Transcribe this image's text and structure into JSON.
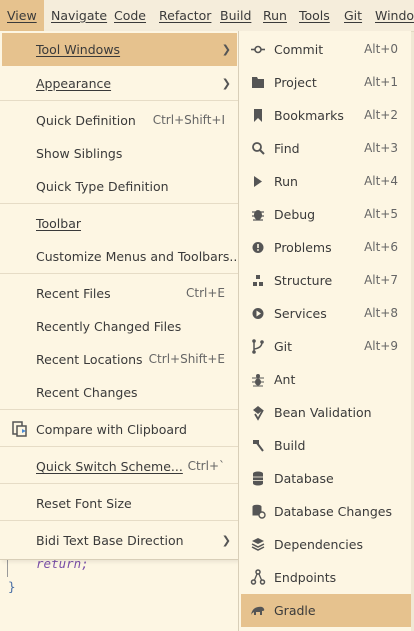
{
  "menubar": {
    "items": [
      "View",
      "Navigate",
      "Code",
      "Refactor",
      "Build",
      "Run",
      "Tools",
      "Git",
      "Window"
    ]
  },
  "view_menu": {
    "items": [
      {
        "label": "Tool Windows",
        "shortcut": "",
        "submenu": true,
        "selected": true
      },
      {
        "label": "Appearance",
        "shortcut": "",
        "submenu": true
      },
      {
        "label": "Quick Definition",
        "shortcut": "Ctrl+Shift+I"
      },
      {
        "label": "Show Siblings",
        "shortcut": ""
      },
      {
        "label": "Quick Type Definition",
        "shortcut": ""
      },
      {
        "label": "Toolbar",
        "shortcut": ""
      },
      {
        "label": "Customize Menus and Toolbars...",
        "shortcut": ""
      },
      {
        "label": "Recent Files",
        "shortcut": "Ctrl+E"
      },
      {
        "label": "Recently Changed Files",
        "shortcut": ""
      },
      {
        "label": "Recent Locations",
        "shortcut": "Ctrl+Shift+E"
      },
      {
        "label": "Recent Changes",
        "shortcut": ""
      },
      {
        "label": "Compare with Clipboard",
        "shortcut": "",
        "icon": "compare-icon"
      },
      {
        "label": "Quick Switch Scheme...",
        "shortcut": "Ctrl+`"
      },
      {
        "label": "Reset Font Size",
        "shortcut": ""
      },
      {
        "label": "Bidi Text Base Direction",
        "shortcut": "",
        "submenu": true
      }
    ]
  },
  "tool_windows": {
    "items": [
      {
        "label": "Commit",
        "shortcut": "Alt+0",
        "icon": "commit-icon"
      },
      {
        "label": "Project",
        "shortcut": "Alt+1",
        "icon": "folder-icon"
      },
      {
        "label": "Bookmarks",
        "shortcut": "Alt+2",
        "icon": "bookmark-icon"
      },
      {
        "label": "Find",
        "shortcut": "Alt+3",
        "icon": "search-icon"
      },
      {
        "label": "Run",
        "shortcut": "Alt+4",
        "icon": "play-icon"
      },
      {
        "label": "Debug",
        "shortcut": "Alt+5",
        "icon": "bug-icon"
      },
      {
        "label": "Problems",
        "shortcut": "Alt+6",
        "icon": "problems-icon"
      },
      {
        "label": "Structure",
        "shortcut": "Alt+7",
        "icon": "structure-icon"
      },
      {
        "label": "Services",
        "shortcut": "Alt+8",
        "icon": "services-icon"
      },
      {
        "label": "Git",
        "shortcut": "Alt+9",
        "icon": "git-branch-icon"
      },
      {
        "label": "Ant",
        "shortcut": "",
        "icon": "ant-icon"
      },
      {
        "label": "Bean Validation",
        "shortcut": "",
        "icon": "bean-validation-icon"
      },
      {
        "label": "Build",
        "shortcut": "",
        "icon": "hammer-icon"
      },
      {
        "label": "Database",
        "shortcut": "",
        "icon": "database-icon"
      },
      {
        "label": "Database Changes",
        "shortcut": "",
        "icon": "database-changes-icon"
      },
      {
        "label": "Dependencies",
        "shortcut": "",
        "icon": "layers-icon"
      },
      {
        "label": "Endpoints",
        "shortcut": "",
        "icon": "endpoints-icon"
      },
      {
        "label": "Gradle",
        "shortcut": "",
        "icon": "gradle-icon",
        "selected": true
      }
    ]
  },
  "editor": {
    "line1": "return;",
    "line2": "}"
  },
  "colors": {
    "background": "#fdf6e3",
    "selection": "#e6c28e",
    "keyword": "#7a4fa8"
  }
}
